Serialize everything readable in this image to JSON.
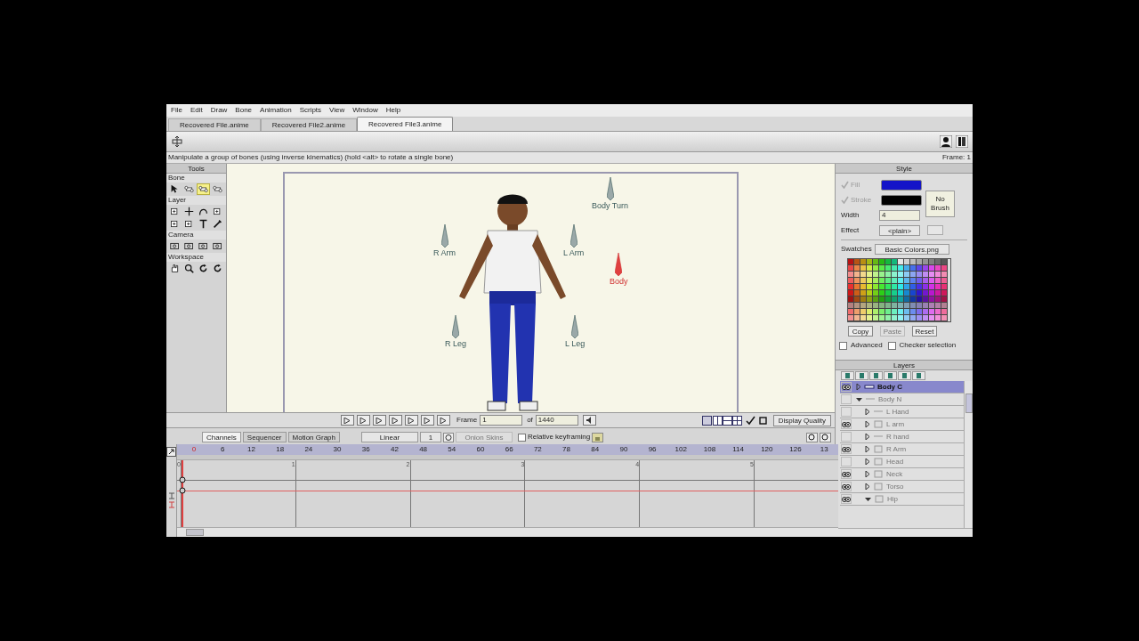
{
  "menu": [
    "File",
    "Edit",
    "Draw",
    "Bone",
    "Animation",
    "Scripts",
    "View",
    "Window",
    "Help"
  ],
  "tabs": [
    {
      "label": "Recovered File.anime",
      "selected": false
    },
    {
      "label": "Recovered File2.anime",
      "selected": false
    },
    {
      "label": "Recovered File3.anime",
      "selected": true
    }
  ],
  "status_text": "Manipulate a group of bones (using inverse kinematics) (hold <alt> to rotate a single bone)",
  "frame_status": "Frame: 1",
  "tools": {
    "title": "Tools",
    "groups": [
      {
        "title": "Bone",
        "tools": [
          {
            "kind": "arrow",
            "selected": false
          },
          {
            "kind": "bone",
            "selected": false
          },
          {
            "kind": "bone",
            "selected": true
          },
          {
            "kind": "bone",
            "selected": false
          }
        ]
      },
      {
        "title": "Layer",
        "tools": [
          {
            "kind": "layer",
            "selected": false
          },
          {
            "kind": "plus",
            "selected": false
          },
          {
            "kind": "curve",
            "selected": false
          },
          {
            "kind": "layer",
            "selected": false
          },
          {
            "kind": "layer",
            "selected": false
          },
          {
            "kind": "layer",
            "selected": false
          },
          {
            "kind": "text",
            "selected": false
          },
          {
            "kind": "dropper",
            "selected": false
          }
        ]
      },
      {
        "title": "Camera",
        "tools": [
          {
            "kind": "camera",
            "selected": false
          },
          {
            "kind": "camera",
            "selected": false
          },
          {
            "kind": "camera",
            "selected": false
          },
          {
            "kind": "camera",
            "selected": false
          }
        ]
      },
      {
        "title": "Workspace",
        "tools": [
          {
            "kind": "hand",
            "selected": false
          },
          {
            "kind": "magnifier",
            "selected": false
          },
          {
            "kind": "rotate",
            "selected": false
          },
          {
            "kind": "rotate",
            "selected": false
          }
        ]
      }
    ]
  },
  "bones": [
    {
      "label": "R Arm",
      "selected": false
    },
    {
      "label": "L Arm",
      "selected": false
    },
    {
      "label": "Body Turn",
      "selected": false
    },
    {
      "label": "Body",
      "selected": true
    },
    {
      "label": "R Leg",
      "selected": false
    },
    {
      "label": "L Leg",
      "selected": false
    }
  ],
  "style": {
    "title": "Style",
    "fill": {
      "label": "Fill",
      "checked": true,
      "color": "#1414c8"
    },
    "stroke": {
      "label": "Stroke",
      "checked": true,
      "color": "#000000"
    },
    "width_label": "Width",
    "width_value": "4",
    "no_brush": "No Brush",
    "effect_label": "Effect",
    "effect_value": "<plain>",
    "swatches_label": "Swatches",
    "swatches_value": "Basic Colors.png",
    "buttons": [
      {
        "label": "Copy",
        "disabled": false
      },
      {
        "label": "Paste",
        "disabled": true
      },
      {
        "label": "Reset",
        "disabled": false
      }
    ],
    "options": [
      {
        "label": "Advanced",
        "checked": false
      },
      {
        "label": "Checker selection",
        "checked": false
      }
    ]
  },
  "layers": {
    "title": "Layers",
    "items": [
      {
        "name": "Body C",
        "kind": "bone",
        "visible": true,
        "expanded": false,
        "selected": true
      },
      {
        "name": "Body N",
        "kind": "group",
        "visible": false,
        "expanded": true,
        "selected": false,
        "children": [
          {
            "name": "L Hand",
            "kind": "group",
            "visible": false,
            "expanded": false,
            "selected": false
          },
          {
            "name": "L arm",
            "kind": "image",
            "visible": true,
            "expanded": false,
            "selected": false
          },
          {
            "name": "R hand",
            "kind": "group",
            "visible": false,
            "expanded": false,
            "selected": false
          },
          {
            "name": "R Arm",
            "kind": "image",
            "visible": true,
            "expanded": false,
            "selected": false
          },
          {
            "name": "Head",
            "kind": "image",
            "visible": false,
            "expanded": false,
            "selected": false
          },
          {
            "name": "Neck",
            "kind": "image",
            "visible": true,
            "expanded": false,
            "selected": false
          },
          {
            "name": "Torso",
            "kind": "image",
            "visible": true,
            "expanded": false,
            "selected": false
          },
          {
            "name": "Hip",
            "kind": "image",
            "visible": true,
            "expanded": true,
            "selected": false
          }
        ]
      }
    ]
  },
  "playback": {
    "frame_label": "Frame",
    "frame_value": "1",
    "of_label": "of",
    "total": "1440",
    "quality": "Display Quality"
  },
  "timeline": {
    "tabs": [
      {
        "label": "Channels",
        "selected": true
      },
      {
        "label": "Sequencer",
        "selected": false
      },
      {
        "label": "Motion Graph",
        "selected": false
      }
    ],
    "interpolation": "Linear",
    "step": "1",
    "onion": "Onion Skins",
    "relative": {
      "label": "Relative keyframing",
      "checked": false
    },
    "ruler": [
      "0",
      "6",
      "12",
      "18",
      "24",
      "30",
      "36",
      "42",
      "48",
      "54",
      "60",
      "66",
      "72",
      "78",
      "84",
      "90",
      "96",
      "102",
      "108",
      "114",
      "120",
      "126",
      "13"
    ],
    "seconds": [
      "0",
      "1",
      "2",
      "3",
      "4",
      "5"
    ]
  }
}
